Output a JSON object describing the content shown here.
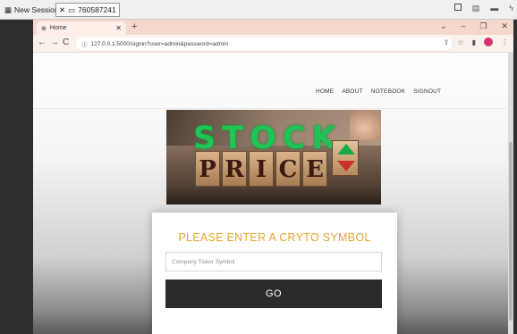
{
  "session": {
    "new_session_label": "New Session",
    "session_id": "760587241"
  },
  "browser": {
    "tab_title": "Home",
    "url": "127.0.0.1:5000/signin?user=admin&password=admin"
  },
  "nav": {
    "items": [
      "HOME",
      "ABOUT",
      "NOTEBOOK",
      "SIGNOUT"
    ]
  },
  "hero": {
    "line1": "STOCK",
    "line2_blocks": [
      "P",
      "R",
      "I",
      "C",
      "E"
    ]
  },
  "form": {
    "title": "PLEASE ENTER A CRYTO SYMBOL",
    "input_placeholder": "Company Ticker Symbol",
    "input_value": "",
    "button_label": "GO"
  },
  "colors": {
    "title_accent": "#e3a72f",
    "button_bg": "#2b2b2b",
    "tab_strip": "#f5d8cc"
  }
}
